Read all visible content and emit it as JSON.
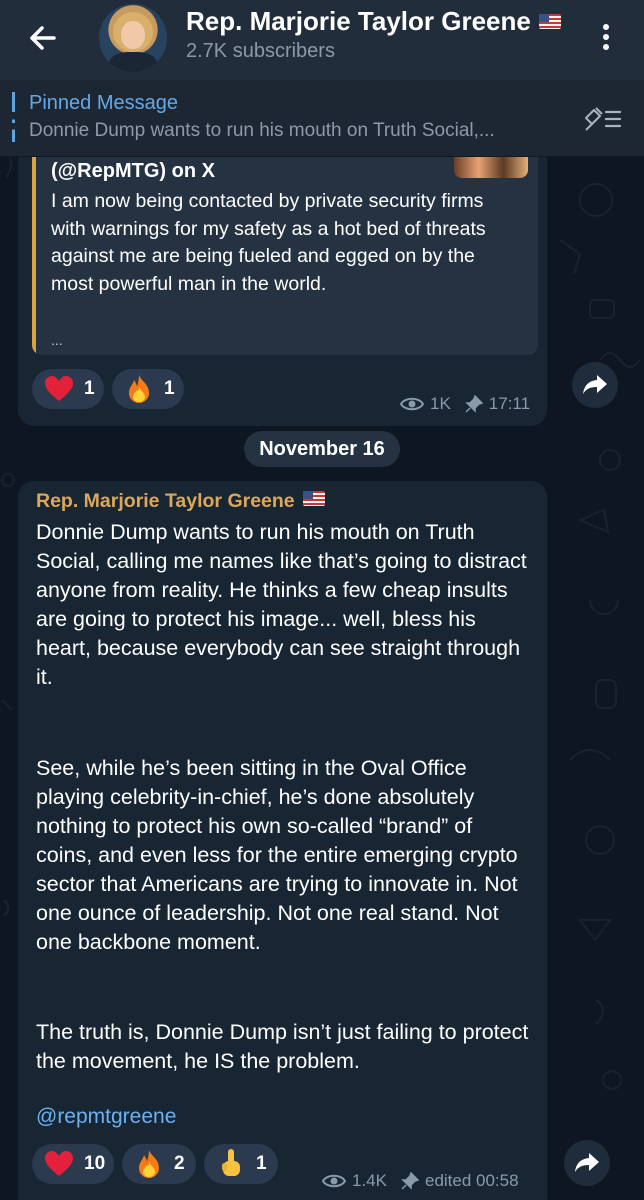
{
  "header": {
    "title": "Rep. Marjorie Taylor Greene",
    "subscribers": "2.7K subscribers"
  },
  "pinned": {
    "title": "Pinned Message",
    "text": "Donnie Dump wants to run his mouth on Truth Social,..."
  },
  "message1": {
    "quote_source": "(@RepMTG) on X",
    "quote_text": "I am now being contacted by private security firms with warnings for my safety as a hot bed of threats against me are being fueled and egged on by the most powerful man in the world.",
    "quote_ellipsis": "...",
    "reactions": [
      {
        "emoji": "red-heart",
        "count": "1"
      },
      {
        "emoji": "fire",
        "count": "1"
      }
    ],
    "views": "1K",
    "time": "17:11"
  },
  "date_separator": "November 16",
  "message2": {
    "sender": "Rep. Marjorie Taylor Greene",
    "paragraphs": [
      "Donnie Dump wants to run his mouth on Truth Social, calling me names like that’s going to distract anyone from reality. He thinks a few cheap insults are going to protect his image... well, bless his heart, because everybody can see straight through it.",
      "See, while he’s been sitting in the Oval Office playing celebrity-in-chief, he’s done absolutely nothing to protect his own so-called “brand” of coins, and even less for the entire emerging crypto sector that Americans are trying to innovate in. Not one ounce of leadership. Not one real stand. Not one backbone moment.",
      "The truth is, Donnie Dump isn’t just failing to protect the movement, he IS the problem."
    ],
    "mention": "@repmtgreene",
    "reactions": [
      {
        "emoji": "red-heart",
        "count": "10"
      },
      {
        "emoji": "fire",
        "count": "2"
      },
      {
        "emoji": "middle-finger",
        "count": "1"
      }
    ],
    "views": "1.4K",
    "edited": "edited 00:58"
  },
  "colors": {
    "background": "#0e1621",
    "header": "#212d3b",
    "bubble": "#182533",
    "accent_blue": "#64a9e6",
    "sender_gold": "#dba75a",
    "quote_bar": "#d8a245"
  }
}
